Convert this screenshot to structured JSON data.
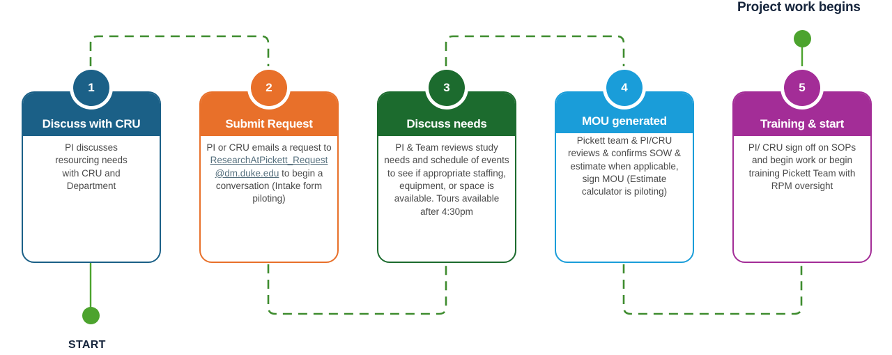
{
  "diagram": {
    "title_top_right": "Project work begins",
    "label_start": "START",
    "accent_green": "#4CA32E",
    "label_color": "#16253C",
    "connector_style": "green dashed"
  },
  "steps": [
    {
      "number": "1",
      "title": "Discuss with CRU",
      "color": "#1B6087",
      "body_lines": [
        "PI discusses",
        "resourcing needs",
        "with CRU and",
        "Department"
      ]
    },
    {
      "number": "2",
      "title": "Submit Request",
      "color": "#E8702A",
      "body_before": "PI or CRU emails a request to ",
      "email": "ResearchAtPickett_Request@dm.duke.edu",
      "body_after": " to begin a conversation (Intake form piloting)"
    },
    {
      "number": "3",
      "title": "Discuss needs",
      "color": "#1C6B2E",
      "body_lines": [
        "PI & Team reviews study needs and schedule of events to see if appropriate staffing, equipment, or space is available. Tours available after 4:30pm"
      ]
    },
    {
      "number": "4",
      "title": "MOU generated",
      "color": "#1A9DD9",
      "body_lines": [
        "Pickett team & PI/CRU reviews & confirms SOW & estimate when applicable, sign MOU (Estimate calculator is piloting)"
      ]
    },
    {
      "number": "5",
      "title": "Training & start",
      "color": "#A32D97",
      "body_lines": [
        "PI/ CRU sign off on SOPs and begin work or begin training Pickett Team with RPM oversight"
      ]
    }
  ]
}
